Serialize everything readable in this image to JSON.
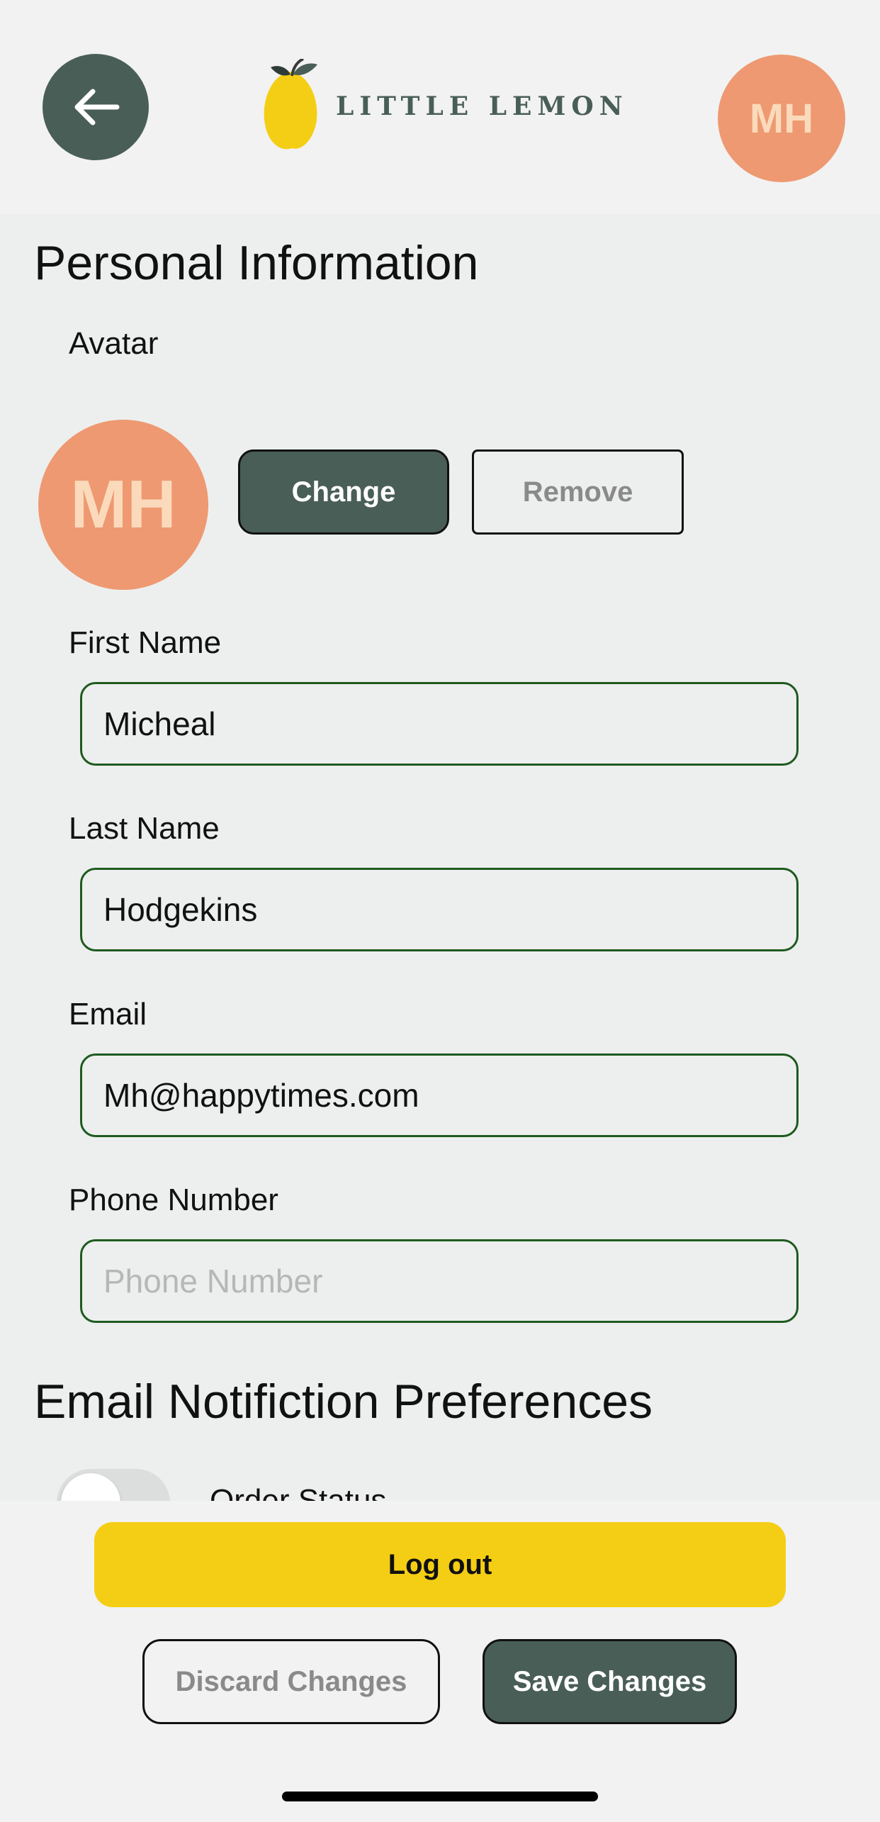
{
  "header": {
    "brand": "LITTLE LEMON",
    "avatar_initials": "MH"
  },
  "personal_info": {
    "title": "Personal Information",
    "avatar_label": "Avatar",
    "avatar_initials": "MH",
    "change_label": "Change",
    "remove_label": "Remove"
  },
  "fields": {
    "first_name": {
      "label": "First Name",
      "value": "Micheal",
      "placeholder": ""
    },
    "last_name": {
      "label": "Last Name",
      "value": "Hodgekins",
      "placeholder": ""
    },
    "email": {
      "label": "Email",
      "value": "Mh@happytimes.com",
      "placeholder": ""
    },
    "phone": {
      "label": "Phone Number",
      "value": "",
      "placeholder": "Phone Number"
    }
  },
  "notifications": {
    "title": "Email Notifiction Preferences",
    "items": [
      {
        "label": "Order Status",
        "enabled": false
      }
    ]
  },
  "footer": {
    "logout_label": "Log out",
    "discard_label": "Discard Changes",
    "save_label": "Save Changes"
  },
  "colors": {
    "primary_green": "#495e57",
    "accent_yellow": "#f4ce14",
    "avatar_salmon": "#ee9972",
    "avatar_text": "#fbdabb",
    "field_border": "#1f5a1f"
  },
  "icons": {
    "back": "arrow-left-icon",
    "logo": "lemon-icon"
  }
}
